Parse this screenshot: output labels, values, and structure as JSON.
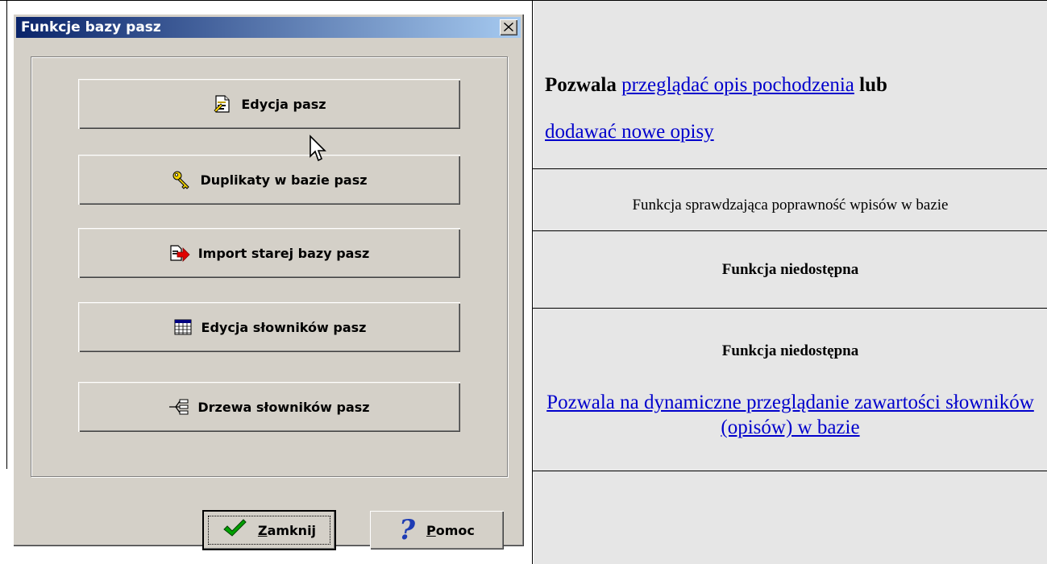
{
  "dialog": {
    "title": "Funkcje bazy pasz",
    "buttons": [
      {
        "label": "Edycja pasz",
        "icon": "edit-document-icon"
      },
      {
        "label": "Duplikaty w bazie pasz",
        "icon": "key-icon"
      },
      {
        "label": "Import starej bazy pasz",
        "icon": "import-arrow-icon"
      },
      {
        "label": "Edycja słowników pasz",
        "icon": "table-icon"
      },
      {
        "label": "Drzewa słowników pasz",
        "icon": "tree-icon"
      }
    ],
    "close_button": {
      "prefix": "",
      "underlined": "Z",
      "rest": "amknij",
      "icon": "checkmark-icon"
    },
    "help_button": {
      "underlined": "P",
      "rest": "omoc",
      "icon": "question-mark-icon"
    }
  },
  "descriptions": {
    "row1": {
      "bold_prefix": "Pozwala",
      "link1": "przeglądać opis pochodzenia",
      "bold_mid": "lub",
      "link2": "dodawać nowe opisy"
    },
    "row2": "Funkcja sprawdzająca poprawność wpisów w bazie",
    "row3": "Funkcja niedostępna",
    "row4": "Funkcja niedostępna",
    "row5_link": "Pozwala na dynamiczne przeglądanie zawartości słowników (opisów) w bazie"
  },
  "colors": {
    "title_gradient_start": "#0a246a",
    "title_gradient_end": "#a6caf0",
    "dialog_face": "#d4d0c8",
    "link": "#0000cc",
    "cell_bg": "#e6e6e6"
  }
}
